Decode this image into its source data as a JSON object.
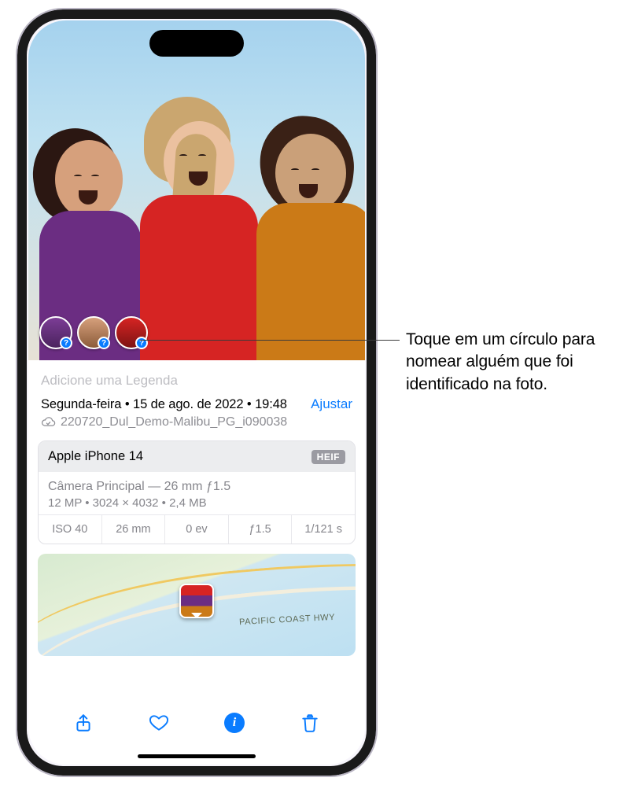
{
  "callout": {
    "text": "Toque em um círculo para nomear alguém que foi identificado na foto."
  },
  "caption_placeholder": "Adicione uma Legenda",
  "meta": {
    "date_line": "Segunda-feira • 15 de ago. de 2022 • 19:48",
    "adjust_label": "Ajustar",
    "filename": "220720_Dul_Demo-Malibu_PG_i090038"
  },
  "camera_card": {
    "device": "Apple iPhone 14",
    "format_badge": "HEIF",
    "lens_line": "Câmera Principal — 26 mm ƒ1.5",
    "specs_line": "12 MP  •  3024 × 4032  •  2,4 MB",
    "iso": "ISO 40",
    "focal": "26 mm",
    "ev": "0 ev",
    "aperture": "ƒ1.5",
    "shutter": "1/121 s"
  },
  "map": {
    "road_label": "PACIFIC COAST HWY"
  },
  "faces": {
    "badge_glyph": "?"
  },
  "toolbar": {
    "share": "share",
    "favorite": "favorite",
    "info": "info",
    "delete": "delete"
  }
}
